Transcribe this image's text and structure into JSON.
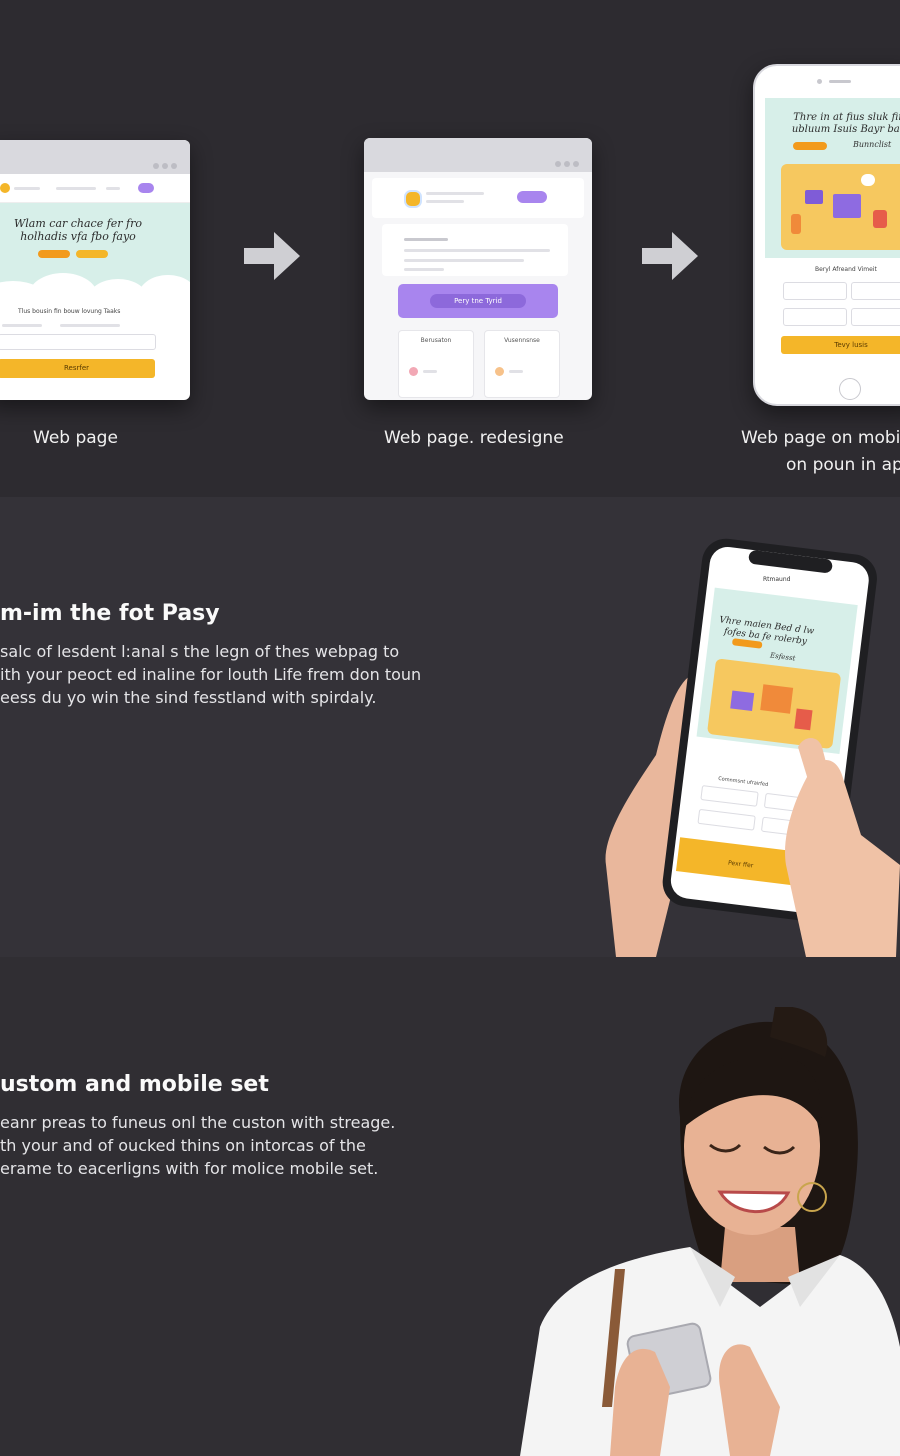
{
  "flow": {
    "step1": {
      "caption": "Web page",
      "hero_text": "Wlam car chace fer fro holhadis vfa fbo fayo",
      "form_label": "Tlus bousin fin bouw lovung Taaks",
      "button_label": "Resrfer"
    },
    "step2": {
      "caption": "Web page. redesigne",
      "banner_label": "Pery tne Tyrid",
      "card1_title": "Berusaton",
      "card2_title": "Vusennsnse"
    },
    "step3": {
      "caption_line1": "Web page on mobile",
      "caption_line2": "on poun in ap",
      "hero_text": "Thre in at fius sluk fin ubluum Isuis Bayr ban",
      "hero_tag": "Bunnclist",
      "form_label": "Beryl Afreand Vimeit",
      "button_label": "Tevy lusis"
    }
  },
  "feature1": {
    "title": "m-im the fot Pasy",
    "lines": [
      "salc of lesdent l:anal s the legn of thes webpag to",
      "ith your peoct ed inaline for louth Life frem don toun",
      "eess du yo win the sind fesstland with spirdaly."
    ],
    "phone": {
      "status": "Rtmaund",
      "hero_text": "Vhre maien Bed d lw fofes ba fe rolerby",
      "hero_tag": "Esfesst",
      "form_label": "Comnmsnt ufrairfed",
      "button_label": "Pexr ffer"
    }
  },
  "feature2": {
    "title": "ustom and mobile set",
    "lines": [
      "eanr preas to funeus onl the custon with streage.",
      "th your and of oucked thins on intorcas of the",
      "erame to eacerligns with for molice mobile set."
    ]
  },
  "colors": {
    "background": "#2e2c31",
    "accent_yellow": "#f4b629",
    "accent_purple": "#a885ee",
    "mint": "#d7efe9"
  }
}
